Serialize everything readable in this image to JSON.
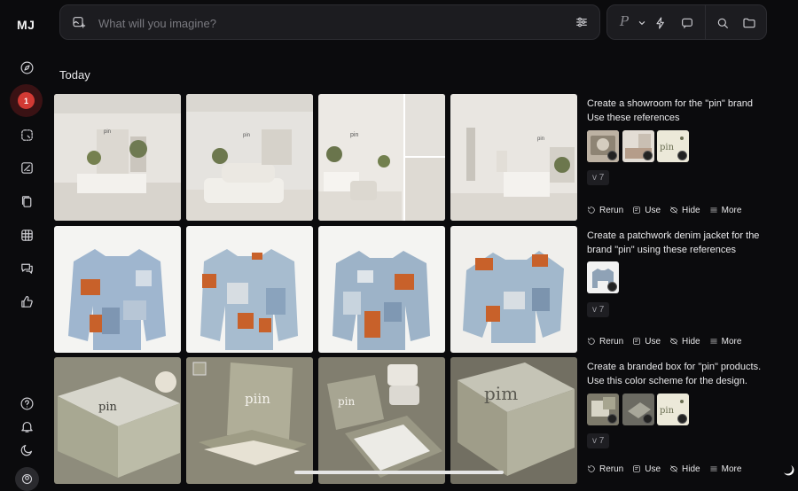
{
  "app": {
    "logo": "MJ"
  },
  "sidebar": {
    "notification_count": "1",
    "items": [
      {
        "name": "explore",
        "icon": "compass-icon"
      },
      {
        "name": "create",
        "icon": "create-icon"
      },
      {
        "name": "edit",
        "icon": "edit-icon"
      },
      {
        "name": "personalize",
        "icon": "palette-icon"
      },
      {
        "name": "organize",
        "icon": "copy-icon"
      },
      {
        "name": "tables",
        "icon": "grid-icon"
      },
      {
        "name": "chat",
        "icon": "chat-icon"
      },
      {
        "name": "rank",
        "icon": "thumbs-up-icon"
      }
    ],
    "bottom": [
      "help-icon",
      "bell-icon",
      "moon-icon",
      "profile-icon"
    ]
  },
  "search": {
    "placeholder": "What will you imagine?",
    "style_letter": "P"
  },
  "feed": {
    "section_title": "Today",
    "actions": {
      "rerun": "Rerun",
      "use": "Use",
      "hide": "Hide",
      "more": "More"
    },
    "jobs": [
      {
        "prompt_line1": "Create a showroom for the \"pin\" brand",
        "prompt_line2": "Use these references",
        "version": "v 7",
        "ref_count": 3,
        "theme": "showroom"
      },
      {
        "prompt_line1": "Create a patchwork denim jacket for the",
        "prompt_line2": "brand \"pin\" using these references",
        "version": "v 7",
        "ref_count": 1,
        "theme": "denim"
      },
      {
        "prompt_line1": "Create a branded box for \"pin\" products.",
        "prompt_line2": "Use this color scheme for the design.",
        "version": "v 7",
        "ref_count": 3,
        "theme": "box"
      }
    ],
    "box_logos": [
      "pin",
      "piin",
      "pin",
      "pim"
    ],
    "showroom_logos": [
      "pin",
      "pin",
      "pin",
      "pin"
    ],
    "ref_text": "pin"
  },
  "colors": {
    "background": "#0b0b0d",
    "panel": "#1c1c20",
    "badge": "#d23a34",
    "showroom_wall": "#e7e4df",
    "denim": "#9fb6cf",
    "denim_patch": "#c8612a",
    "box": "#a8a892"
  }
}
